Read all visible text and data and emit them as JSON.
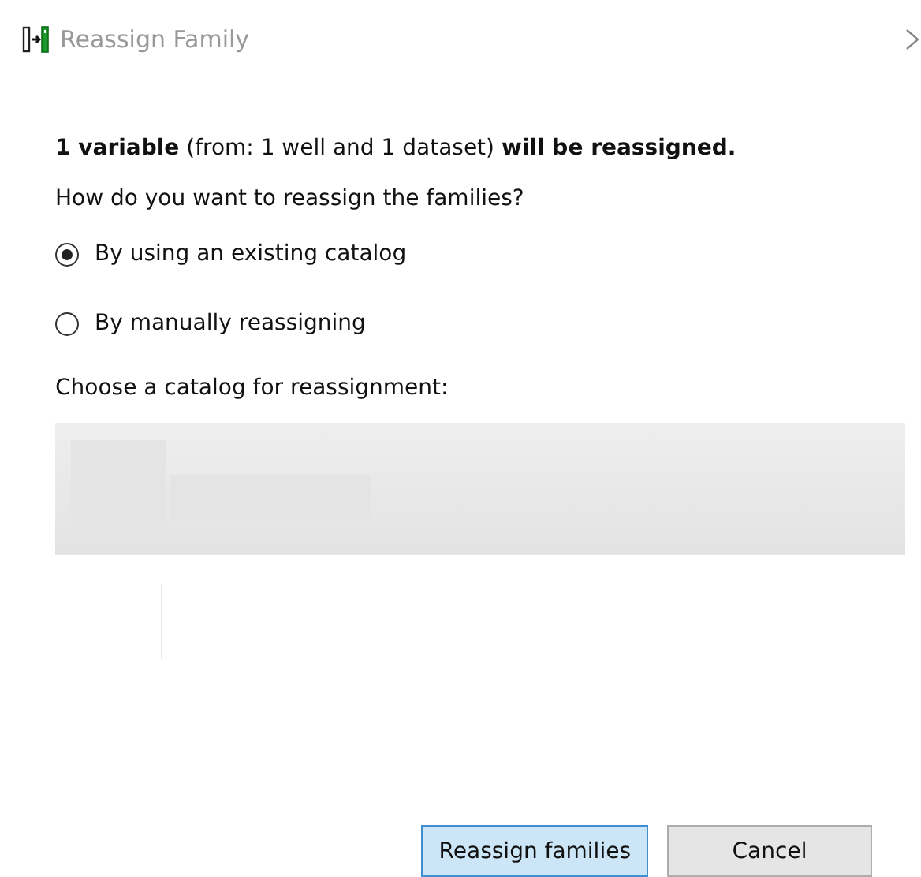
{
  "window": {
    "title": "Reassign Family"
  },
  "summary": "**1 variable** (from: 1 well and 1 dataset) **will be reassigned.**",
  "question": "How do you want to reassign the families?",
  "options": [
    {
      "label": "By using an existing catalog",
      "selected": true
    },
    {
      "label": "By manually reassigning",
      "selected": false
    }
  ],
  "catalog_label": "Choose a catalog for reassignment:",
  "buttons": [
    {
      "label": "Reassign families",
      "kind": "primary"
    },
    {
      "label": "Cancel",
      "kind": "secondary"
    }
  ]
}
